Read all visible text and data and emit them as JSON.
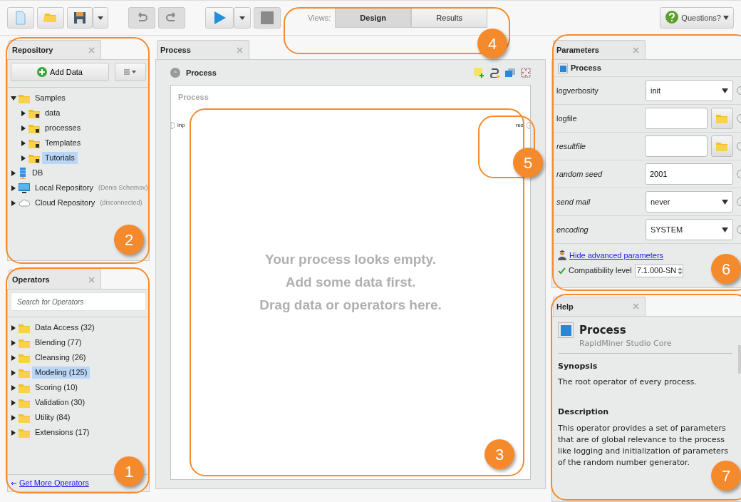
{
  "toolbar": {
    "views_label": "Views:",
    "views": [
      {
        "label": "Design",
        "selected": true
      },
      {
        "label": "Results",
        "selected": false
      }
    ],
    "questions": "Questions?"
  },
  "repository": {
    "tab": "Repository",
    "add_button": "Add Data",
    "tree": [
      {
        "label": "Samples",
        "kind": "folder",
        "expanded": true,
        "selected": false,
        "children": [
          {
            "label": "data",
            "kind": "locked",
            "expanded": false,
            "selected": false
          },
          {
            "label": "processes",
            "kind": "locked",
            "expanded": false,
            "selected": false
          },
          {
            "label": "Templates",
            "kind": "locked",
            "expanded": false,
            "selected": false
          },
          {
            "label": "Tutorials",
            "kind": "locked",
            "expanded": false,
            "selected": true
          }
        ]
      },
      {
        "label": "DB",
        "kind": "database",
        "expanded": false,
        "selected": false
      },
      {
        "label": "Local Repository",
        "note": "(Denis Schernov)",
        "kind": "computer",
        "expanded": false,
        "selected": false
      },
      {
        "label": "Cloud Repository",
        "note": "(disconnected)",
        "kind": "cloud",
        "expanded": false,
        "selected": false
      }
    ]
  },
  "operators": {
    "tab": "Operators",
    "search": {
      "placeholder": "Search for Operators"
    },
    "items": [
      {
        "label": "Data Access (32)",
        "selected": false
      },
      {
        "label": "Blending (77)",
        "selected": false
      },
      {
        "label": "Cleansing (26)",
        "selected": false
      },
      {
        "label": "Modeling (125)",
        "selected": true
      },
      {
        "label": "Scoring (10)",
        "selected": false
      },
      {
        "label": "Validation (30)",
        "selected": false
      },
      {
        "label": "Utility (84)",
        "selected": false
      },
      {
        "label": "Extensions (17)",
        "selected": false
      }
    ],
    "link": "Get More Operators"
  },
  "process": {
    "tab": "Process",
    "breadcrumb": "Process",
    "canvas_title": "Process",
    "input_port": "inp",
    "output_port": "res",
    "empty_message": [
      "Your process looks empty.",
      "Add some data first.",
      "Drag data or operators here."
    ]
  },
  "parameters": {
    "tab": "Parameters",
    "operator": "Process",
    "rows": [
      {
        "label": "logverbosity",
        "kind": "select",
        "value": "init",
        "optional": false
      },
      {
        "label": "logfile",
        "kind": "file",
        "value": "",
        "optional": false
      },
      {
        "label": "resultfile",
        "kind": "file",
        "value": "",
        "optional": true
      },
      {
        "label": "random seed",
        "kind": "text",
        "value": "2001",
        "optional": true
      },
      {
        "label": "send mail",
        "kind": "select",
        "value": "never",
        "optional": true
      },
      {
        "label": "encoding",
        "kind": "select",
        "value": "SYSTEM",
        "optional": true
      }
    ],
    "advanced_link": "Hide advanced parameters",
    "compatibility_label": "Compatibility level",
    "compatibility_value": "7.1.000-SN"
  },
  "help": {
    "tab": "Help",
    "title": "Process",
    "subtitle": "RapidMiner Studio Core",
    "sections": [
      {
        "heading": "Synopsis",
        "text": "The root operator of every process."
      },
      {
        "heading": "Description",
        "text": "This operator provides a set of parameters that are of global relevance to the process like logging and initialization of parameters of the random number generator."
      }
    ]
  },
  "callouts": [
    "1",
    "2",
    "3",
    "4",
    "5",
    "6",
    "7"
  ]
}
